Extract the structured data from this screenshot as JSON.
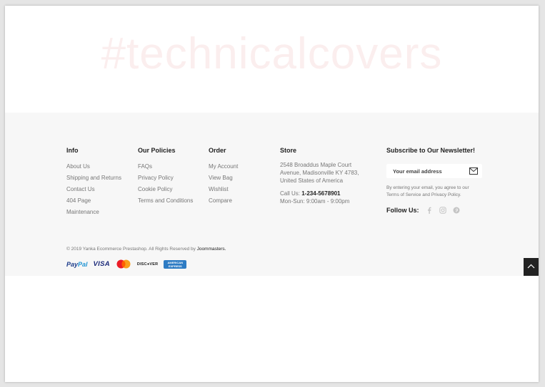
{
  "hero": {
    "hashtag": "#technicalcovers"
  },
  "footer": {
    "info": {
      "title": "Info",
      "links": [
        "About Us",
        "Shipping and Returns",
        "Contact Us",
        "404 Page",
        "Maintenance"
      ]
    },
    "policies": {
      "title": "Our Policies",
      "links": [
        "FAQs",
        "Privacy Policy",
        "Cookie Policy",
        "Terms and Conditions"
      ]
    },
    "order": {
      "title": "Order",
      "links": [
        "My Account",
        "View Bag",
        "Wishlist",
        "Compare"
      ]
    },
    "store": {
      "title": "Store",
      "address_line1": "2548 Broaddus Maple Court",
      "address_line2": "Avenue, Madisonville KY 4783,",
      "address_line3": "United States of America",
      "call_label": "Call Us: ",
      "phone": "1-234-5678901",
      "hours": "Mon-Sun: 9:00am - 9:00pm"
    },
    "newsletter": {
      "title": "Subscribe to Our Newsletter!",
      "email_placeholder": "Your email address",
      "terms_line1": "By entering your email, you agree to our",
      "terms_line2": "Terms of Service and Privacy Policy.",
      "follow_label": "Follow Us:",
      "social_icons": [
        "facebook-icon",
        "instagram-icon",
        "pinterest-icon"
      ]
    },
    "copyright": {
      "text": "© 2019 Yanka Ecommerce Prestashop. All Rights Reserved by ",
      "brand": "Joommasters."
    },
    "payments": {
      "paypal_a": "Pay",
      "paypal_b": "Pal",
      "visa": "VISA",
      "discover": "DISC●VER",
      "amex_a": "AMERICAN",
      "amex_b": "EXPRESS"
    }
  },
  "colors": {
    "footer_bg": "#f7f7f7",
    "heading": "#222222",
    "link": "#777777",
    "hashtag": "#fbeeee",
    "back_to_top": "#222222"
  }
}
